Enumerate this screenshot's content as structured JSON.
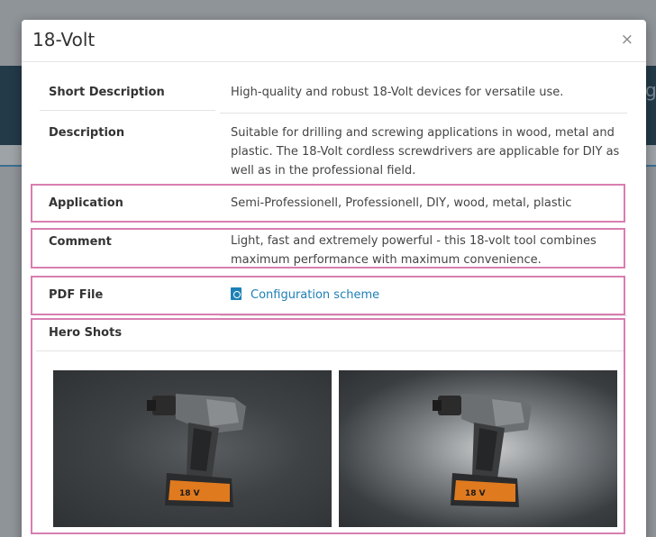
{
  "modal": {
    "title": "18-Volt",
    "close_label": "×"
  },
  "rows": {
    "short_description": {
      "label": "Short Description",
      "value": "High-quality and robust 18-Volt devices for versatile use."
    },
    "description": {
      "label": "Description",
      "line1": "Suitable for drilling and screwing applications in wood, metal and",
      "line2": "plastic. The 18-Volt cordless screwdrivers are applicable for DIY as",
      "line3": "well as in the professional field."
    },
    "application": {
      "label": "Application",
      "value": "Semi-Professionell, Professionell, DIY, wood, metal, plastic"
    },
    "comment": {
      "label": "Comment",
      "line1": "Light, fast and extremely powerful - this 18-volt tool combines",
      "line2": "maximum performance with maximum convenience."
    },
    "pdf_file": {
      "label": "PDF File",
      "link_text": "Configuration scheme",
      "icon": "pdf-file-icon"
    },
    "hero_shots": {
      "label": "Hero Shots",
      "images": [
        "drill-hero-shot-dark",
        "drill-hero-shot-spotlight"
      ],
      "battery_label": "18 V"
    }
  },
  "background": {
    "partial_char": "g"
  },
  "colors": {
    "highlight_border": "#d87eb1",
    "link": "#1d80b6",
    "drill_accent": "#e07a1f"
  }
}
